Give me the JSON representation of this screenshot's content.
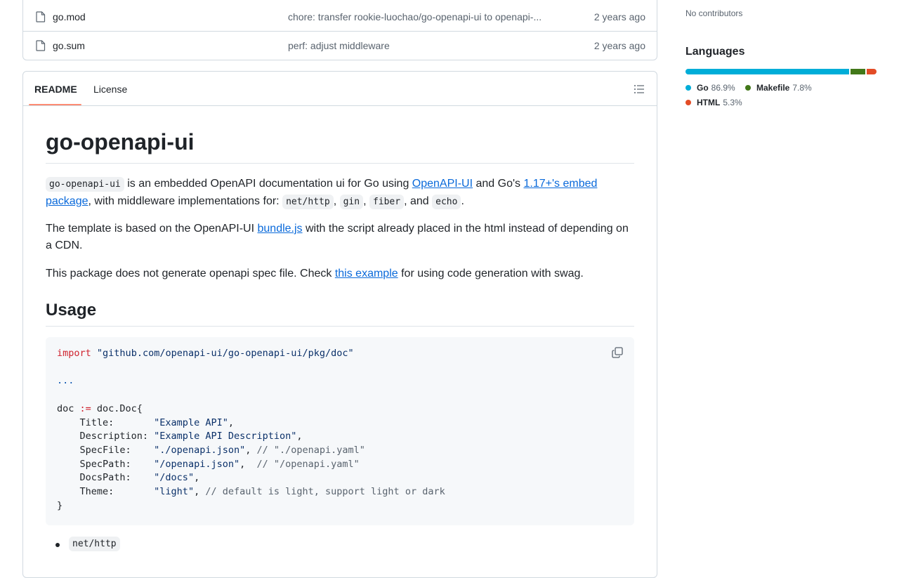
{
  "files": [
    {
      "name": "go.mod",
      "message": "chore: transfer rookie-luochao/go-openapi-ui to openapi-...",
      "age": "2 years ago"
    },
    {
      "name": "go.sum",
      "message": "perf: adjust middleware",
      "age": "2 years ago"
    }
  ],
  "readme": {
    "tabs": {
      "readme": "README",
      "license": "License"
    },
    "title": "go-openapi-ui",
    "p1": {
      "code_name": "go-openapi-ui",
      "t1": " is an embedded OpenAPI documentation ui for Go using ",
      "link1": "OpenAPI-UI",
      "t2": " and Go's ",
      "link2": "1.17+'s embed package",
      "t3": ", with middleware implementations for: ",
      "c1": "net/http",
      "sep1": ", ",
      "c2": "gin",
      "sep2": ", ",
      "c3": "fiber",
      "sep3": ", and ",
      "c4": "echo",
      "end": "."
    },
    "p2": {
      "t1": "The template is based on the OpenAPI-UI ",
      "link": "bundle.js",
      "t2": " with the script already placed in the html instead of depending on a CDN."
    },
    "p3": {
      "t1": "This package does not generate openapi spec file. Check ",
      "link": "this example",
      "t2": " for using code generation with swag."
    },
    "usage_heading": "Usage",
    "code": {
      "import_kw": "import",
      "import_path": "\"github.com/openapi-ui/go-openapi-ui/pkg/doc\"",
      "ellipsis": "...",
      "decl_var": "doc ",
      "decl_op": ":=",
      "decl_rest": " doc.Doc{",
      "fields": [
        {
          "key": "    Title:       ",
          "value": "\"Example API\"",
          "tail": ",",
          "comment": ""
        },
        {
          "key": "    Description: ",
          "value": "\"Example API Description\"",
          "tail": ",",
          "comment": ""
        },
        {
          "key": "    SpecFile:    ",
          "value": "\"./openapi.json\"",
          "tail": ", ",
          "comment": "// \"./openapi.yaml\""
        },
        {
          "key": "    SpecPath:    ",
          "value": "\"/openapi.json\"",
          "tail": ",  ",
          "comment": "// \"/openapi.yaml\""
        },
        {
          "key": "    DocsPath:    ",
          "value": "\"/docs\"",
          "tail": ",",
          "comment": ""
        },
        {
          "key": "    Theme:       ",
          "value": "\"light\"",
          "tail": ", ",
          "comment": "// default is light, support light or dark"
        }
      ],
      "close": "}"
    },
    "list_items": [
      "net/http"
    ]
  },
  "sidebar": {
    "contributors": "No contributors",
    "languages_heading": "Languages",
    "languages": [
      {
        "name": "Go",
        "percent": "86.9%",
        "value": 86.9,
        "color": "#00ADD8"
      },
      {
        "name": "Makefile",
        "percent": "7.8%",
        "value": 7.8,
        "color": "#427819"
      },
      {
        "name": "HTML",
        "percent": "5.3%",
        "value": 5.3,
        "color": "#e34c26"
      }
    ]
  }
}
